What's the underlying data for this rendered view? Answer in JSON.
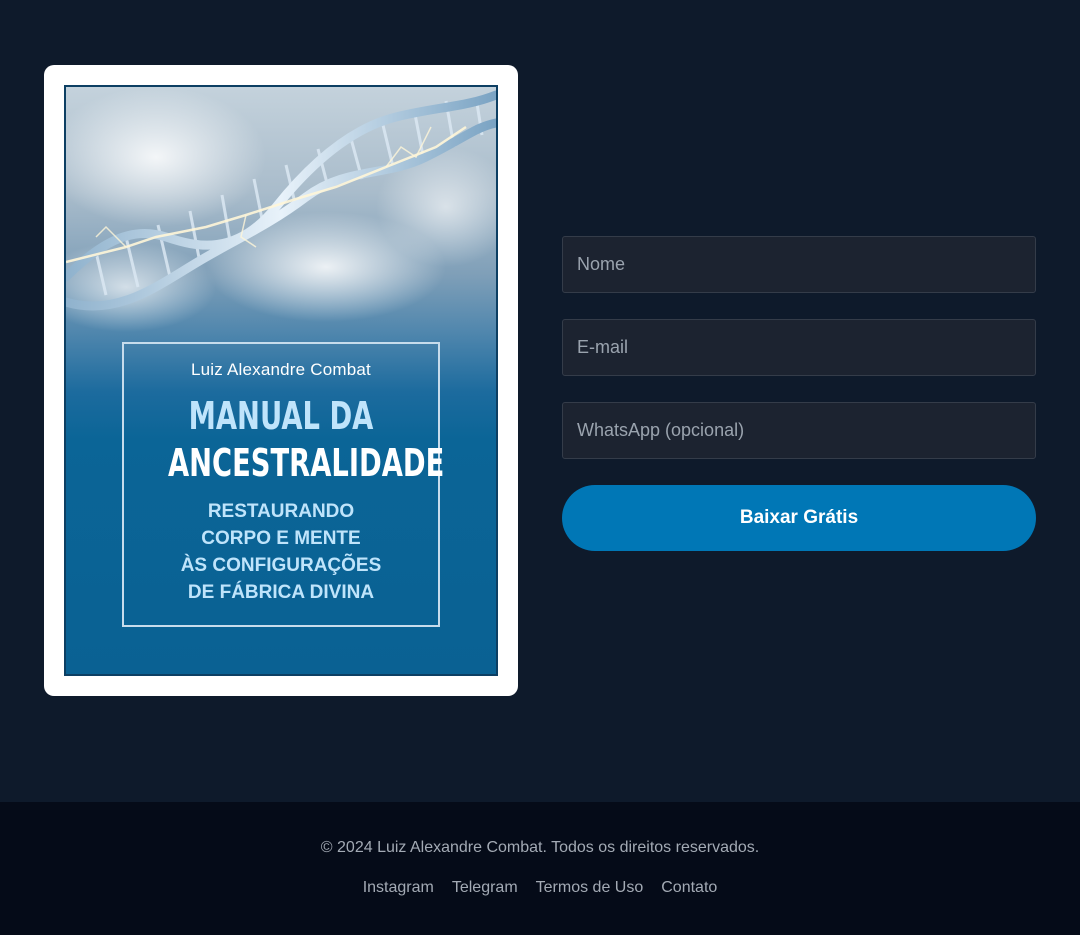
{
  "book": {
    "author": "Luiz Alexandre Combat",
    "title_line1": "MANUAL DA",
    "title_line2": "ANCESTRALIDADE",
    "subtitle_lines": [
      "RESTAURANDO",
      "CORPO E MENTE",
      "ÀS CONFIGURAÇÕES",
      "DE FÁBRICA DIVINA"
    ]
  },
  "form": {
    "name_placeholder": "Nome",
    "email_placeholder": "E-mail",
    "whatsapp_placeholder": "WhatsApp (opcional)",
    "submit_label": "Baixar Grátis"
  },
  "footer": {
    "copyright": "© 2024 Luiz Alexandre Combat. Todos os direitos reservados.",
    "links": [
      "Instagram",
      "Telegram",
      "Termos de Uso",
      "Contato"
    ]
  },
  "colors": {
    "background": "#0e1a2b",
    "footer_background": "#050b18",
    "accent": "#0077b6",
    "input_background": "#1c2330"
  },
  "icons": [
    "dna-helix-illustration"
  ]
}
